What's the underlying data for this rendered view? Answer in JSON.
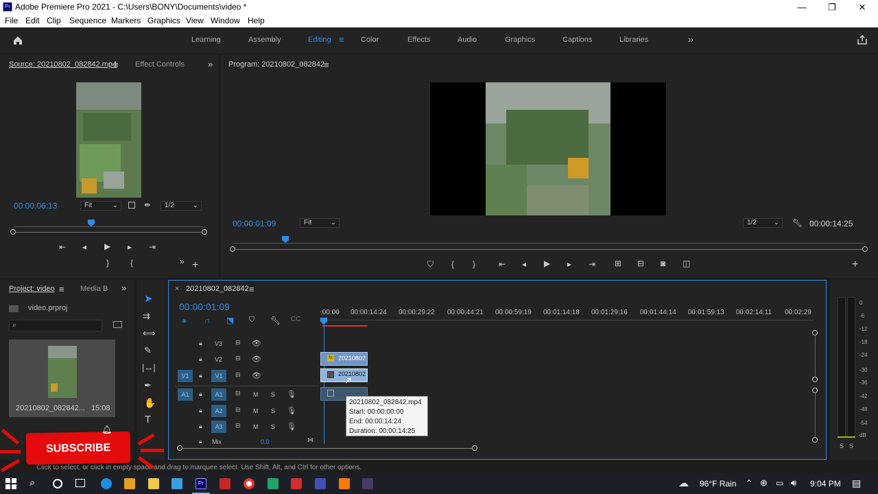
{
  "window": {
    "title": "Adobe Premiere Pro 2021 - C:\\Users\\BONY\\Documents\\video *",
    "logo_text": "Pr",
    "controls": [
      "—",
      "❐",
      "✕"
    ]
  },
  "menu": [
    "File",
    "Edit",
    "Clip",
    "Sequence",
    "Markers",
    "Graphics",
    "View",
    "Window",
    "Help"
  ],
  "workspaces": {
    "items": [
      "Learning",
      "Assembly",
      "Editing",
      "Color",
      "Effects",
      "Audio",
      "Graphics",
      "Captions",
      "Libraries"
    ],
    "active": "Editing",
    "more": "»"
  },
  "source": {
    "tab_source": "Source: 20210802_082842.mp4",
    "tab_effects": "Effect Controls",
    "timecode": "00:00:06:13",
    "fit": "Fit",
    "resolution": "1/2",
    "more": "»",
    "add": "+"
  },
  "program": {
    "tab": "Program: 20210802_082842",
    "timecode": "00:00:01:09",
    "fit": "Fit",
    "resolution": "1/2",
    "duration": "00:00:14:25",
    "add": "+"
  },
  "project": {
    "tab": "Project: video",
    "tab2": "Media B",
    "more": "»",
    "file": "video.prproj",
    "clip_name": "20210802_082842...",
    "clip_duration": "15:08"
  },
  "timeline": {
    "tab": "20210802_082842",
    "close": "×",
    "timecode": "00:00:01:09",
    "ruler": [
      ":00:00",
      "00:00:14:24",
      "00:00:29:22",
      "00:00:44:21",
      "00:00:59:19",
      "00:01:14:18",
      "00:01:29:16",
      "00:01:44:14",
      "00:01:59:13",
      "00:02:14:11",
      "00:02:29"
    ],
    "tracks_video": [
      "V3",
      "V2",
      "V1"
    ],
    "tracks_audio": [
      "A1",
      "A2",
      "A3"
    ],
    "src_v": "V1",
    "src_a": "A1",
    "mix_label": "Mix",
    "mix_value": "0.0",
    "clip_v2": "20210802",
    "clip_v1": "20210802",
    "tooltip": {
      "name": "20210802_082842.mp4",
      "start": "Start: 00:00:00:00",
      "end": "End: 00:00:14:24",
      "duration": "Duration: 00:00:14:25"
    }
  },
  "meter": {
    "ticks": [
      "0",
      "-6",
      "-12",
      "-18",
      "-24",
      "-30",
      "-36",
      "-42",
      "-48",
      "-54",
      "dB"
    ],
    "solo": [
      "S",
      "S"
    ]
  },
  "overlay": {
    "subscribe": "SUBSCRIBE"
  },
  "status": {
    "hint": "Click to select, or click in empty space and drag to marquee select. Use Shift, Alt, and Ctrl for other options."
  },
  "taskbar": {
    "weather": "96°F  Rain",
    "time": "9:04 PM"
  },
  "colors": {
    "accent": "#2d8ceb",
    "panel": "#232323",
    "clip_video": "#8fb3dd",
    "clip_fx": "#6f95c6",
    "subscribe_red": "#e30b0b"
  }
}
